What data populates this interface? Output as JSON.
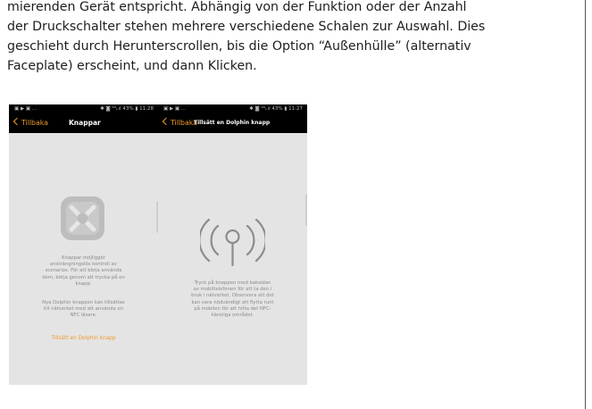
{
  "document": {
    "lines": [
      "mierenden Gerät entspricht. Abhängig von der Funktion oder der Anzahl",
      "der Druckschalter stehen mehrere verschiedene Schalen zur Auswahl. Dies",
      "geschieht durch Herunterscrollen, bis die Option “Außenhülle” (alternativ",
      "Faceplate) erscheint, und dann Klicken."
    ]
  },
  "phone1": {
    "status_left": "▣ ▶ ▣ ...",
    "status_right": "✱ ◙ ⁹⁰ₗ.ıl 43% ▮ 11:28",
    "back_label": "Tillbaka",
    "title": "Knappar",
    "icon": "dolphin-button-icon",
    "paragraph1": [
      "Knappar möjliggör",
      "ansträngningslös kontroll av",
      "scenarios. För att börja använda",
      "dem, börja genom att trycka på en",
      "knapp."
    ],
    "paragraph2": [
      "Nya Dolphin knappen kan tillsättas",
      "till nätverket med att använda en",
      "NFC läsare."
    ],
    "add_button_label": "Tillsätt en Dolphin knapp",
    "help_icon_label": "?",
    "colors": {
      "accent": "#f19a2e",
      "background": "#e4e4e4",
      "bar": "#000000"
    }
  },
  "phone2": {
    "status_left": "▣ ▶ ▣ ...",
    "status_right": "✱ ◙ ⁹⁰ₗ.ıl 43% ▮ 11:27",
    "back_label": "Tillbaka",
    "title": "Tillsätt en Dolphin knapp",
    "icon": "nfc-antenna-icon",
    "paragraph": [
      "Tryck på knappen med baksidan",
      "av mobiltelefonen för att ta den i",
      "bruk i nätverket. Observera att det",
      "kan vara nödvändigt att flytta runt",
      "på mobilen för att hitta det NFC-",
      "känsliga området."
    ]
  }
}
